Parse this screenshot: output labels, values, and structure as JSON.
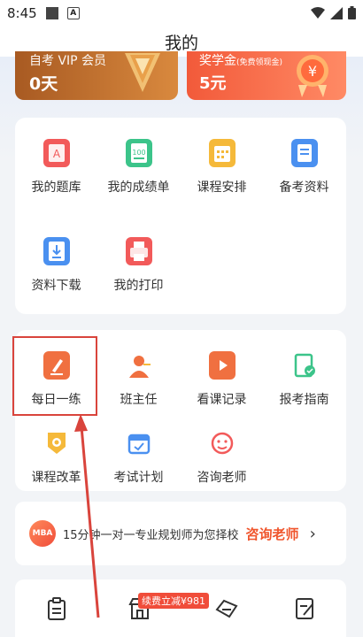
{
  "status_bar": {
    "time": "8:45",
    "a_glyph": "A",
    "icons": [
      "wifi-icon",
      "signal-icon",
      "battery-icon"
    ]
  },
  "header": {
    "title": "我的"
  },
  "vip_card": {
    "title": "自考 VIP 会员",
    "value": "0天",
    "icon": "diamond-icon"
  },
  "scholarship_card": {
    "title": "奖学金",
    "note": "(免费领现金)",
    "value": "5元",
    "icon": "yen-medal-icon"
  },
  "section1": {
    "items": [
      {
        "label": "我的题库",
        "icon": "question-bank-icon",
        "color": "#f25a5a"
      },
      {
        "label": "我的成绩单",
        "icon": "score-report-icon",
        "color": "#3cc48a"
      },
      {
        "label": "课程安排",
        "icon": "calendar-icon",
        "color": "#f5b93a"
      },
      {
        "label": "备考资料",
        "icon": "document-icon",
        "color": "#4a90f0"
      },
      {
        "label": "资料下载",
        "icon": "download-icon",
        "color": "#4a90f0"
      },
      {
        "label": "我的打印",
        "icon": "printer-icon",
        "color": "#f25a5a"
      }
    ]
  },
  "section2": {
    "items": [
      {
        "label": "每日一练",
        "icon": "daily-practice-icon",
        "color": "#f07040"
      },
      {
        "label": "班主任",
        "icon": "class-teacher-icon",
        "color": "#f07040"
      },
      {
        "label": "看课记录",
        "icon": "video-record-icon",
        "color": "#f07040"
      },
      {
        "label": "报考指南",
        "icon": "exam-guide-icon",
        "color": "#3cc48a"
      },
      {
        "label": "课程改革",
        "icon": "course-reform-icon",
        "color": "#f5b93a"
      },
      {
        "label": "考试计划",
        "icon": "exam-plan-icon",
        "color": "#4a90f0"
      },
      {
        "label": "咨询老师",
        "icon": "consult-teacher-icon",
        "color": "#f25a5a"
      }
    ]
  },
  "banner": {
    "logo": "MBA",
    "text": "15分钟一对一专业规划师为您择校",
    "link": "咨询老师",
    "chevron": "›"
  },
  "bottom_bar": {
    "promo": "续费立减¥981",
    "icons": [
      "clipboard-icon",
      "store-icon",
      "ticket-icon",
      "edit-note-icon"
    ]
  },
  "colors": {
    "accent": "#f0552c",
    "highlight": "#d9443c"
  }
}
